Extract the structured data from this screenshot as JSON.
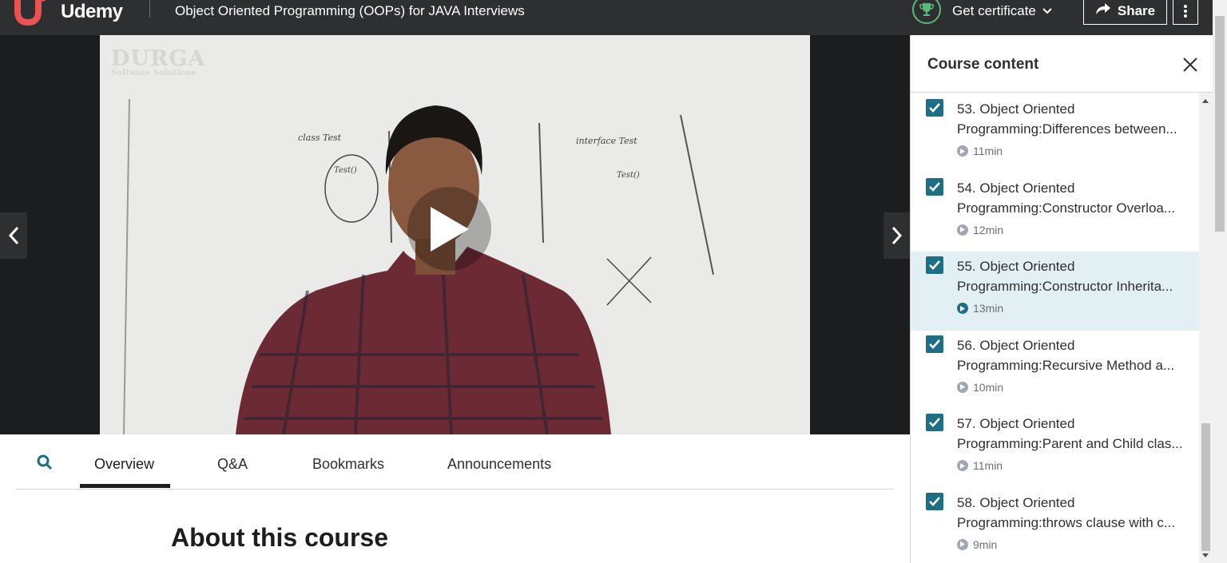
{
  "header": {
    "brand": "Udemy",
    "course_title": "Object Oriented Programming (OOPs) for JAVA Interviews",
    "certificate_label": "Get certificate",
    "share_label": "Share"
  },
  "video": {
    "watermark_line1": "DURGA",
    "watermark_line2": "Software Solutions"
  },
  "tabs": [
    {
      "label": "Overview",
      "active": true
    },
    {
      "label": "Q&A",
      "active": false
    },
    {
      "label": "Bookmarks",
      "active": false
    },
    {
      "label": "Announcements",
      "active": false
    }
  ],
  "main": {
    "about_heading": "About this course"
  },
  "sidebar": {
    "title": "Course content",
    "items": [
      {
        "line1": "53. Object Oriented",
        "line2": "Programming:Differences between...",
        "duration": "11min",
        "checked": true,
        "current": false
      },
      {
        "line1": "54. Object Oriented",
        "line2": "Programming:Constructor Overloa...",
        "duration": "12min",
        "checked": true,
        "current": false
      },
      {
        "line1": "55. Object Oriented",
        "line2": "Programming:Constructor Inherita...",
        "duration": "13min",
        "checked": true,
        "current": true
      },
      {
        "line1": "56. Object Oriented",
        "line2": "Programming:Recursive Method a...",
        "duration": "10min",
        "checked": true,
        "current": false
      },
      {
        "line1": "57. Object Oriented",
        "line2": "Programming:Parent and Child clas...",
        "duration": "11min",
        "checked": true,
        "current": false
      },
      {
        "line1": "58. Object Oriented",
        "line2": "Programming:throws clause with c...",
        "duration": "9min",
        "checked": true,
        "current": false
      }
    ]
  },
  "colors": {
    "header_bg": "#2d2f31",
    "accent": "#1e6f85",
    "current_row": "#e3f0f3",
    "brand": "#a435f0"
  }
}
